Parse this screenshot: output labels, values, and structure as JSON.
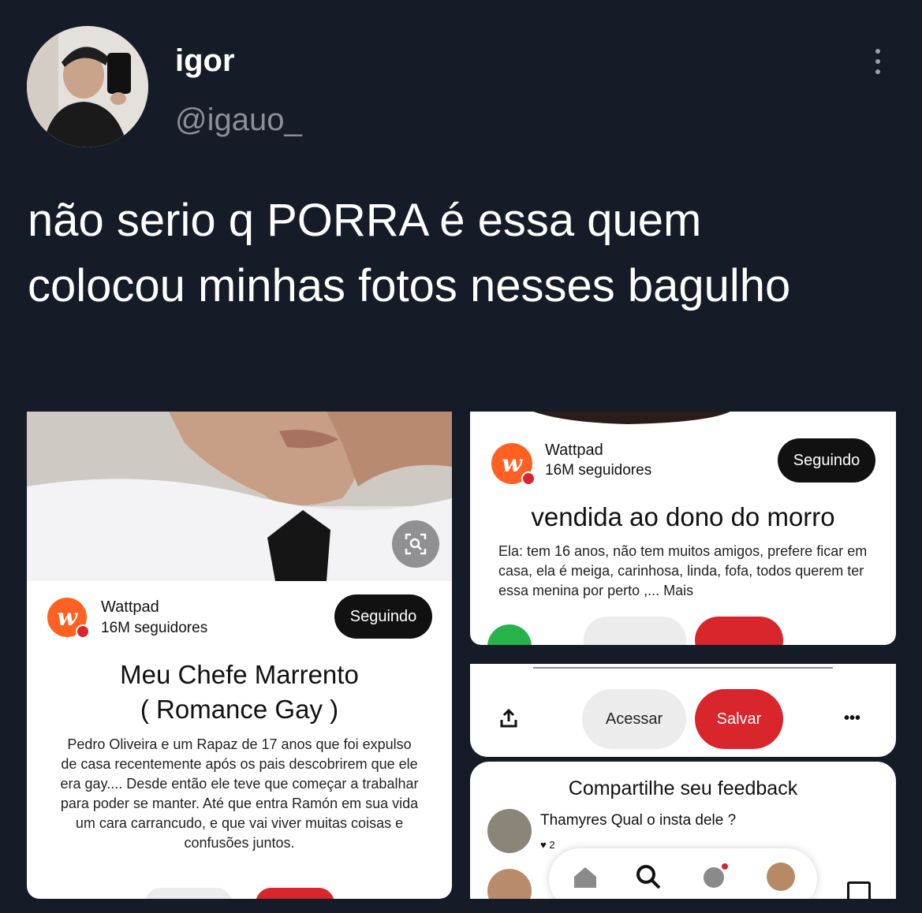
{
  "tweet": {
    "display_name": "igor",
    "handle": "@igauo_",
    "text": "não serio q PORRA é essa quem colocou minhas fotos nesses bagulho"
  },
  "left_card": {
    "brand": "Wattpad",
    "followers": "16M seguidores",
    "follow_label": "Seguindo",
    "title_line1": "Meu Chefe Marrento",
    "title_line2": "( Romance Gay )",
    "description": "Pedro Oliveira e um Rapaz de 17 anos que foi expulso de casa recentemente após os pais descobrirem que ele era gay.... Desde então ele teve que começar a trabalhar para poder se manter. Até que entra Ramón em sua vida um cara carrancudo, e que vai viver muitas coisas e confusões juntos."
  },
  "right_card_top": {
    "brand": "Wattpad",
    "followers": "16M seguidores",
    "follow_label": "Seguindo",
    "title": "vendida ao dono do morro",
    "description": "Ela: tem 16 anos, não tem muitos amigos, prefere ficar em casa, ela é meiga, carinhosa, linda, fofa, todos querem ter essa menina por perto ,... Mais"
  },
  "right_card_actions": {
    "access_label": "Acessar",
    "save_label": "Salvar",
    "more_label": "•••"
  },
  "right_card_feedback": {
    "heading": "Compartilhe seu feedback",
    "comment_user": "Thamyres",
    "comment_text": "Qual o insta dele ?",
    "likes": "2"
  },
  "colors": {
    "background": "#151b27",
    "wattpad_orange": "#ff6122",
    "save_red": "#d8262c"
  }
}
